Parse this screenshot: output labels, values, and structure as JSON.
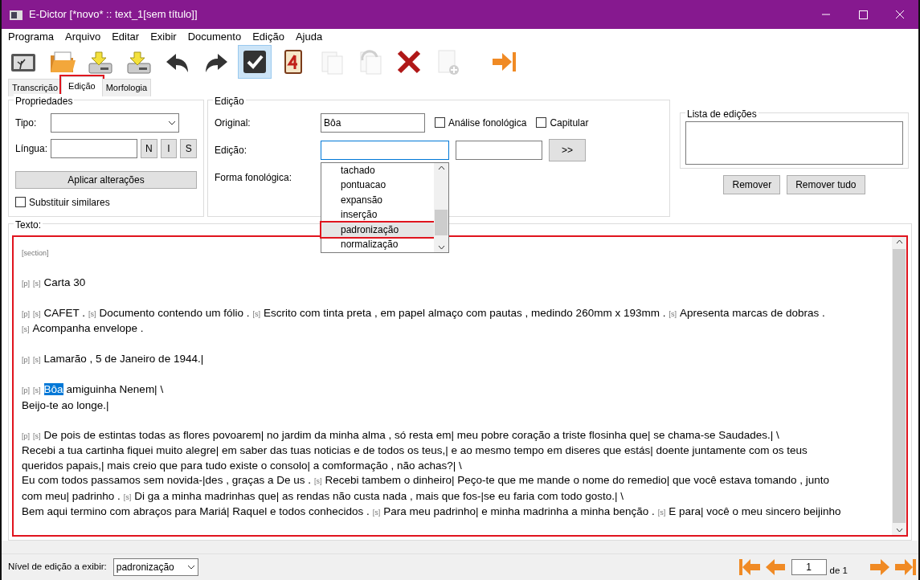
{
  "window": {
    "title": "E-Dictor [*novo* :: text_1[sem título]]"
  },
  "menu": [
    "Programa",
    "Arquivo",
    "Editar",
    "Exibir",
    "Documento",
    "Edição",
    "Ajuda"
  ],
  "toolbar": [
    {
      "kind": "picture-frame",
      "selected": false,
      "disabled": false
    },
    {
      "kind": "folder",
      "selected": false,
      "disabled": false
    },
    {
      "kind": "save",
      "selected": false,
      "disabled": false
    },
    {
      "kind": "save",
      "selected": false,
      "disabled": false
    },
    {
      "kind": "undo",
      "selected": false,
      "disabled": false
    },
    {
      "kind": "redo",
      "selected": false,
      "disabled": false
    },
    {
      "kind": "check",
      "selected": true,
      "disabled": false
    },
    {
      "kind": "calendar",
      "selected": false,
      "disabled": false
    },
    {
      "kind": "pages",
      "selected": false,
      "disabled": true
    },
    {
      "kind": "pages-rotate",
      "selected": false,
      "disabled": true
    },
    {
      "kind": "delete",
      "selected": false,
      "disabled": false
    },
    {
      "kind": "page-add",
      "selected": false,
      "disabled": true
    },
    {
      "kind": "skip",
      "selected": false,
      "disabled": false
    }
  ],
  "tabs": [
    {
      "label": "Transcrição",
      "selected": false,
      "annotated": false
    },
    {
      "label": "Edição",
      "selected": true,
      "annotated": true
    },
    {
      "label": "Morfologia",
      "selected": false,
      "annotated": false
    }
  ],
  "properties": {
    "title": "Propriedades",
    "type_label": "Tipo:",
    "language_label": "Língua:",
    "style_buttons": [
      "N",
      "I",
      "S"
    ],
    "apply_button": "Aplicar alterações",
    "replace_similar": {
      "label": "Substituir similares",
      "checked": false
    }
  },
  "edition": {
    "title": "Edição",
    "original_label": "Original:",
    "original_value": "Bôa",
    "phonological_analysis": {
      "label": "Análise fonológica",
      "checked": false
    },
    "capitalize": {
      "label": "Capitular",
      "checked": false
    },
    "edition_label": "Edição:",
    "add_button": ">>",
    "phonological_form_label": "Forma fonológica:",
    "dropdown": [
      {
        "label": "tachado",
        "selected": false,
        "annotated": false
      },
      {
        "label": "pontuacao",
        "selected": false,
        "annotated": false
      },
      {
        "label": "expansão",
        "selected": false,
        "annotated": false
      },
      {
        "label": "inserção",
        "selected": false,
        "annotated": false
      },
      {
        "label": "padronização",
        "selected": true,
        "annotated": true
      },
      {
        "label": "normalização",
        "selected": false,
        "annotated": false
      }
    ]
  },
  "edit_list": {
    "title": "Lista de edições",
    "buttons": [
      "Remover",
      "Remover tudo"
    ]
  },
  "text_panel": {
    "title": "Texto:",
    "annotated": true,
    "paragraphs": [
      [
        [
          {
            "kind": "tag",
            "text": "[section]"
          }
        ]
      ],
      [
        [
          {
            "kind": "tag",
            "text": "[p]"
          },
          {
            "kind": "tag",
            "text": "[s]"
          },
          {
            "kind": "text",
            "text": "Carta 30"
          }
        ]
      ],
      [
        [
          {
            "kind": "tag",
            "text": "[p]"
          },
          {
            "kind": "tag",
            "text": "[s]"
          },
          {
            "kind": "text",
            "text": "CAFET ."
          },
          {
            "kind": "tag",
            "text": "[s]"
          },
          {
            "kind": "text",
            "text": "Documento contendo um fólio ."
          },
          {
            "kind": "tag",
            "text": "[s]"
          },
          {
            "kind": "text",
            "text": "Escrito com tinta preta , em papel almaço com pautas , medindo 260mm x 193mm ."
          },
          {
            "kind": "tag",
            "text": "[s]"
          },
          {
            "kind": "text",
            "text": "Apresenta marcas de dobras ."
          }
        ],
        [
          {
            "kind": "tag",
            "text": "[s]"
          },
          {
            "kind": "text",
            "text": "Acompanha envelope ."
          }
        ]
      ],
      [
        [
          {
            "kind": "tag",
            "text": "[p]"
          },
          {
            "kind": "tag",
            "text": "[s]"
          },
          {
            "kind": "text",
            "text": "Lamarão , 5 de Janeiro de 1944.|"
          }
        ]
      ],
      [
        [
          {
            "kind": "tag",
            "text": "[p]"
          },
          {
            "kind": "tag",
            "text": "[s]"
          },
          {
            "kind": "selected",
            "text": "Bôa"
          },
          {
            "kind": "text",
            "text": "amiguinha Nenem| \\"
          }
        ],
        [
          {
            "kind": "text",
            "text": "Beijo-te ao longe.|"
          }
        ]
      ],
      [
        [
          {
            "kind": "tag",
            "text": "[p]"
          },
          {
            "kind": "tag",
            "text": "[s]"
          },
          {
            "kind": "text",
            "text": "De pois de estintas todas as flores povoarem| no jardim da minha alma , só resta em| meu pobre coração a triste flosinha que| se chama-se Saudades.| \\"
          }
        ],
        [
          {
            "kind": "text",
            "text": "Recebi a tua cartinha fiquei muito alegre| em saber das tuas noticias e de todos os teus,| e ao mesmo tempo em diseres que estás| doente juntamente com os teus"
          }
        ],
        [
          {
            "kind": "text",
            "text": "queridos papais,| mais creio que para tudo existe o consolo| a comformação , não achas?| \\"
          }
        ],
        [
          {
            "kind": "text",
            "text": "Eu com todos passamos sem novida-|des , graças a De us ."
          },
          {
            "kind": "tag",
            "text": "[s]"
          },
          {
            "kind": "text",
            "text": "Recebi tambem o dinheiro| Peço-te que me mande o nome do remedio| que você estava tomando , junto"
          }
        ],
        [
          {
            "kind": "text",
            "text": "com meu| padrinho ."
          },
          {
            "kind": "tag",
            "text": "[s]"
          },
          {
            "kind": "text",
            "text": "Di ga a minha madrinhas que| as rendas não custa nada , mais que fos-|se eu faria com todo gosto.| \\"
          }
        ],
        [
          {
            "kind": "text",
            "text": "Bem aqui termino com abraços para Mariá| Raquel e todos conhecidos ."
          },
          {
            "kind": "tag",
            "text": "[s]"
          },
          {
            "kind": "text",
            "text": "Para meu padrinho| e minha madrinha a minha benção ."
          },
          {
            "kind": "tag",
            "text": "[s]"
          },
          {
            "kind": "text",
            "text": "E para| você o meu sincero beijinho"
          }
        ]
      ]
    ]
  },
  "footer": {
    "level_label": "Nível de edição a exibir:",
    "level_value": "padronização",
    "page": "1",
    "page_total": "de 1"
  }
}
